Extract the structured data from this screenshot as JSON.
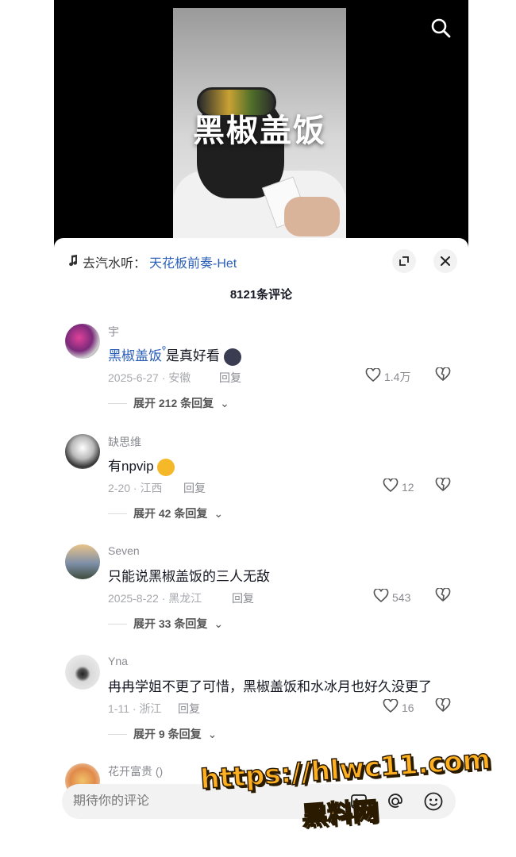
{
  "video": {
    "overlay_title": "黑椒盖饭"
  },
  "panel": {
    "music_prefix": "去汽水听：",
    "music_song": "天花板前奏-Het",
    "comment_count": "8121条评论"
  },
  "comments": [
    {
      "username": "宇",
      "text_link": "黑椒盖饭",
      "text": "是真好看",
      "meta": "2025-6-27 · 安徽",
      "reply_label": "回复",
      "likes": "1.4万",
      "expand": "展开 212 条回复"
    },
    {
      "username": "缺思维",
      "text": "有npvip",
      "meta": "2-20 · 江西",
      "reply_label": "回复",
      "likes": "12",
      "expand": "展开 42 条回复"
    },
    {
      "username": "Seven",
      "text": "只能说黑椒盖饭的三人无敌",
      "meta": "2025-8-22 · 黑龙江",
      "reply_label": "回复",
      "likes": "543",
      "expand": "展开 33 条回复"
    },
    {
      "username": "Yna",
      "text": "冉冉学姐不更了可惜，黑椒盖饭和水冰月也好久没更了",
      "meta": "1-11 · 浙江",
      "reply_label": "回复",
      "likes": "16",
      "expand": "展开 9 条回复"
    },
    {
      "username": "花开富贵 ()"
    }
  ],
  "input": {
    "placeholder": "期待你的评论"
  },
  "watermark": {
    "line1": "https://hlwc11.com",
    "line2": "黑料网"
  },
  "colors": {
    "link_blue": "#2b5fb8",
    "watermark_orange": "#ffb020"
  }
}
